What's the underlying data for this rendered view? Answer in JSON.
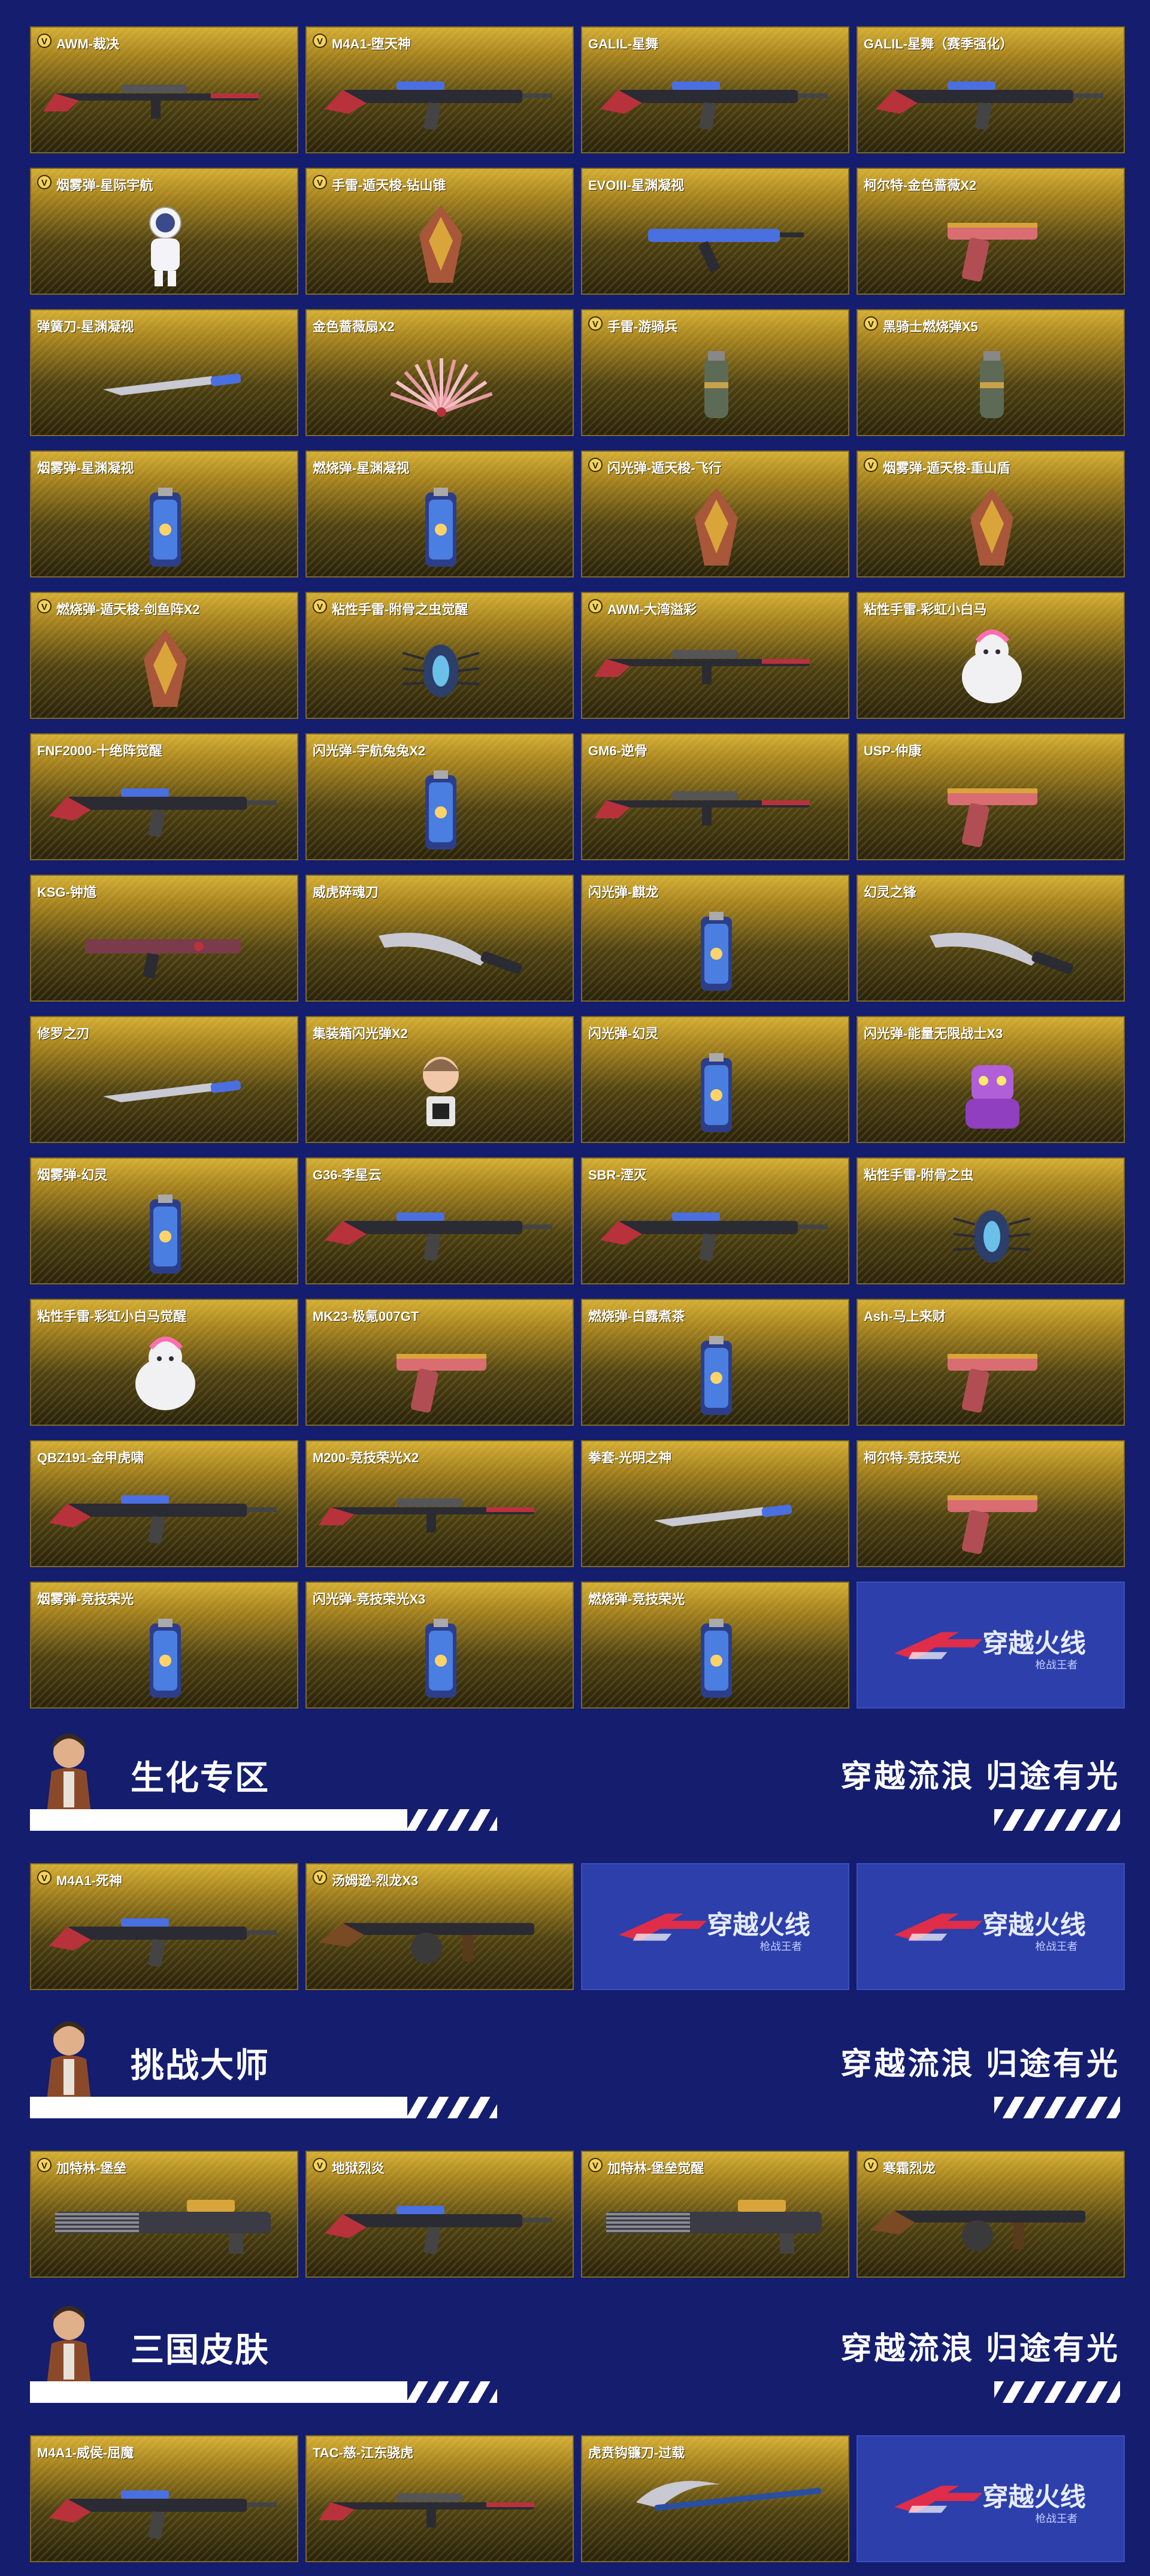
{
  "colors": {
    "page_bg": "#141d6e",
    "card_gold": "#d3ad34",
    "card_dark": "#2a230b",
    "logo_bg": "#2d3faa",
    "logo_accent": "#ff2a3a"
  },
  "logo_text": {
    "main": "穿越火线",
    "sub": "枪战王者"
  },
  "slogan": "穿越流浪 归途有光",
  "grid1": [
    {
      "name": "AWM-裁决",
      "vip": true,
      "icon": "sniper-rifle-icon"
    },
    {
      "name": "M4A1-堕天神",
      "vip": true,
      "icon": "assault-rifle-icon"
    },
    {
      "name": "GALIL-星舞",
      "vip": false,
      "icon": "assault-rifle-icon"
    },
    {
      "name": "GALIL-星舞（赛季强化）",
      "vip": false,
      "icon": "assault-rifle-icon"
    },
    {
      "name": "烟雾弹-星际宇航",
      "vip": true,
      "icon": "astronaut-grenade-icon"
    },
    {
      "name": "手雷-遁天梭-钻山锥",
      "vip": true,
      "icon": "ornate-grenade-icon"
    },
    {
      "name": "EVOIII-星渊凝视",
      "vip": false,
      "icon": "smg-icon"
    },
    {
      "name": "柯尔特-金色蔷薇X2",
      "vip": false,
      "icon": "pistol-icon"
    },
    {
      "name": "弹簧刀-星渊凝视",
      "vip": false,
      "icon": "knife-icon"
    },
    {
      "name": "金色蔷薇扇X2",
      "vip": false,
      "icon": "fan-icon"
    },
    {
      "name": "手雷-游骑兵",
      "vip": true,
      "icon": "grenade-icon"
    },
    {
      "name": "黑骑士燃烧弹X5",
      "vip": true,
      "icon": "grenade-icon"
    },
    {
      "name": "烟雾弹-星渊凝视",
      "vip": false,
      "icon": "canister-icon"
    },
    {
      "name": "燃烧弹-星渊凝视",
      "vip": false,
      "icon": "canister-icon"
    },
    {
      "name": "闪光弹-遁天梭-飞行",
      "vip": true,
      "icon": "ornate-grenade-icon"
    },
    {
      "name": "烟雾弹-遁天梭-重山盾",
      "vip": true,
      "icon": "ornate-grenade-icon"
    },
    {
      "name": "燃烧弹-遁天梭-剑鱼阵X2",
      "vip": true,
      "icon": "ornate-grenade-icon"
    },
    {
      "name": "粘性手雷-附骨之虫觉醒",
      "vip": true,
      "icon": "bug-grenade-icon"
    },
    {
      "name": "AWM-大湾溢彩",
      "vip": true,
      "icon": "sniper-rifle-icon"
    },
    {
      "name": "粘性手雷-彩虹小白马",
      "vip": false,
      "icon": "pony-grenade-icon"
    },
    {
      "name": "FNF2000-十绝阵觉醒",
      "vip": false,
      "icon": "assault-rifle-icon"
    },
    {
      "name": "闪光弹-宇航兔兔X2",
      "vip": false,
      "icon": "canister-icon"
    },
    {
      "name": "GM6-逆骨",
      "vip": false,
      "icon": "sniper-rifle-icon"
    },
    {
      "name": "USP-仲康",
      "vip": false,
      "icon": "pistol-icon"
    },
    {
      "name": "KSG-钟馗",
      "vip": false,
      "icon": "shotgun-icon"
    },
    {
      "name": "威虎碎魂刀",
      "vip": false,
      "icon": "blade-icon"
    },
    {
      "name": "闪光弹-麒龙",
      "vip": false,
      "icon": "canister-icon"
    },
    {
      "name": "幻灵之锋",
      "vip": false,
      "icon": "blade-icon"
    },
    {
      "name": "修罗之刃",
      "vip": false,
      "icon": "knife-icon"
    },
    {
      "name": "集装箱闪光弹X2",
      "vip": false,
      "icon": "figure-grenade-icon"
    },
    {
      "name": "闪光弹-幻灵",
      "vip": false,
      "icon": "canister-icon"
    },
    {
      "name": "闪光弹-能量无限战士X3",
      "vip": false,
      "icon": "robot-grenade-icon"
    },
    {
      "name": "烟雾弹-幻灵",
      "vip": false,
      "icon": "canister-icon"
    },
    {
      "name": "G36-李星云",
      "vip": false,
      "icon": "assault-rifle-icon"
    },
    {
      "name": "SBR-湮灭",
      "vip": false,
      "icon": "assault-rifle-icon"
    },
    {
      "name": "粘性手雷-附骨之虫",
      "vip": false,
      "icon": "bug-grenade-icon"
    },
    {
      "name": "粘性手雷-彩虹小白马觉醒",
      "vip": false,
      "icon": "pony-grenade-icon"
    },
    {
      "name": "MK23-极氪007GT",
      "vip": false,
      "icon": "pistol-icon"
    },
    {
      "name": "燃烧弹-白露煮茶",
      "vip": false,
      "icon": "canister-icon"
    },
    {
      "name": "Ash-马上来财",
      "vip": false,
      "icon": "pistol-icon"
    },
    {
      "name": "QBZ191-金甲虎啸",
      "vip": false,
      "icon": "assault-rifle-icon"
    },
    {
      "name": "M200-竞技荣光X2",
      "vip": false,
      "icon": "sniper-rifle-icon"
    },
    {
      "name": "拳套-光明之神",
      "vip": false,
      "icon": "knife-icon"
    },
    {
      "name": "柯尔特-竞技荣光",
      "vip": false,
      "icon": "pistol-icon"
    },
    {
      "name": "烟雾弹-竞技荣光",
      "vip": false,
      "icon": "canister-icon"
    },
    {
      "name": "闪光弹-竞技荣光X3",
      "vip": false,
      "icon": "canister-icon"
    },
    {
      "name": "燃烧弹-竞技荣光",
      "vip": false,
      "icon": "canister-icon"
    },
    {
      "name": "__logo__",
      "vip": false,
      "icon": "cf-logo-icon"
    }
  ],
  "sections": [
    {
      "title": "生化专区",
      "items": [
        {
          "name": "M4A1-死神",
          "vip": true,
          "icon": "assault-rifle-icon"
        },
        {
          "name": "汤姆逊-烈龙X3",
          "vip": true,
          "icon": "tommy-gun-icon"
        },
        {
          "name": "__logo__",
          "vip": false,
          "icon": "cf-logo-icon"
        },
        {
          "name": "__logo__",
          "vip": false,
          "icon": "cf-logo-icon"
        }
      ]
    },
    {
      "title": "挑战大师",
      "items": [
        {
          "name": "加特林-堡垒",
          "vip": true,
          "icon": "gatling-icon"
        },
        {
          "name": "地狱烈炎",
          "vip": true,
          "icon": "assault-rifle-icon"
        },
        {
          "name": "加特林-堡垒觉醒",
          "vip": true,
          "icon": "gatling-icon"
        },
        {
          "name": "寒霜烈龙",
          "vip": true,
          "icon": "tommy-gun-icon"
        }
      ]
    },
    {
      "title": "三国皮肤",
      "items": [
        {
          "name": "M4A1-威侯-屈魔",
          "vip": false,
          "icon": "assault-rifle-icon"
        },
        {
          "name": "TAC-慈-江东骁虎",
          "vip": false,
          "icon": "sniper-rifle-icon"
        },
        {
          "name": "虎贲钩镰刀-过载",
          "vip": false,
          "icon": "scythe-icon"
        },
        {
          "name": "__logo__",
          "vip": false,
          "icon": "cf-logo-icon"
        }
      ]
    }
  ]
}
